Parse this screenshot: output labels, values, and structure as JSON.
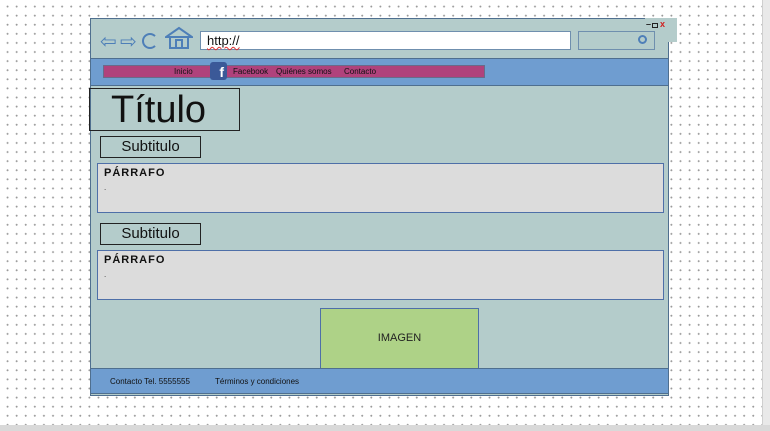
{
  "browser": {
    "url": "http://",
    "window_controls": {
      "minimize": "–",
      "close": "x"
    }
  },
  "nav": {
    "items": [
      {
        "label": "Inicio"
      },
      {
        "label": "Facebook"
      },
      {
        "label": "Quiénes somos"
      },
      {
        "label": "Contacto"
      }
    ],
    "facebook_icon_letter": "f"
  },
  "main": {
    "title": "Título",
    "sections": [
      {
        "subtitle": "Subtitulo",
        "paragraph_label": "PÁRRAFO",
        "paragraph_text": "."
      },
      {
        "subtitle": "Subtitulo",
        "paragraph_label": "PÁRRAFO",
        "paragraph_text": "."
      }
    ],
    "image_label": "IMAGEN"
  },
  "footer": {
    "contact": "Contacto Tel. 5555555",
    "terms": "Términos y condiciones"
  },
  "icons": [
    "back-arrow-icon",
    "forward-arrow-icon",
    "reload-icon",
    "home-icon",
    "search-icon",
    "facebook-icon"
  ],
  "colors": {
    "page_bg": "#b4cccb",
    "bar_blue": "#6f9dd0",
    "menu_magenta": "#b0427c",
    "image_green": "#aed287",
    "paragraph_gray": "#dcdcdc"
  }
}
